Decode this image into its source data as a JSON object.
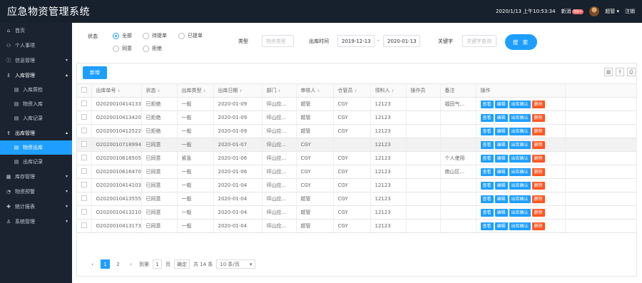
{
  "app": {
    "title": "应急物资管理系统"
  },
  "topbar": {
    "datetime": "2020/1/13 上午10:53:34",
    "news_label": "新消",
    "news_count": "99+",
    "user": "超管",
    "user_arrow": "▾",
    "logout": "注销"
  },
  "sidebar": {
    "items": [
      {
        "label": "首页",
        "icon": "home-icon",
        "glyph": "⌂",
        "arrow": ""
      },
      {
        "label": "个人事项",
        "icon": "user-icon",
        "glyph": "⚇",
        "arrow": ""
      },
      {
        "label": "信息管理",
        "icon": "info-icon",
        "glyph": "ⓘ",
        "arrow": "▾"
      },
      {
        "label": "入库管理",
        "icon": "inbound-icon",
        "glyph": "⇩",
        "arrow": "▴"
      },
      {
        "label": "入库质检",
        "icon": "doc-icon",
        "glyph": "▤",
        "arrow": ""
      },
      {
        "label": "物资入库",
        "icon": "doc-icon",
        "glyph": "▤",
        "arrow": ""
      },
      {
        "label": "入库记录",
        "icon": "doc-icon",
        "glyph": "▤",
        "arrow": ""
      },
      {
        "label": "出库管理",
        "icon": "outbound-icon",
        "glyph": "⇪",
        "arrow": "▴"
      },
      {
        "label": "物资出库",
        "icon": "doc-icon",
        "glyph": "▤",
        "arrow": ""
      },
      {
        "label": "出库记录",
        "icon": "doc-icon",
        "glyph": "▤",
        "arrow": ""
      },
      {
        "label": "库存管理",
        "icon": "stock-icon",
        "glyph": "▦",
        "arrow": "▾"
      },
      {
        "label": "物资预警",
        "icon": "warning-icon",
        "glyph": "◔",
        "arrow": "▾"
      },
      {
        "label": "统计报表",
        "icon": "chart-icon",
        "glyph": "✚",
        "arrow": "▾"
      },
      {
        "label": "系统管理",
        "icon": "settings-icon",
        "glyph": "♙",
        "arrow": "▾"
      }
    ]
  },
  "filters": {
    "status_label": "状态",
    "status_options": [
      "全部",
      "待提单",
      "已提单",
      "同意",
      "拒绝"
    ],
    "status_selected": "全部",
    "type_label": "类型",
    "type_placeholder": "物资类型",
    "date_label": "出库时间",
    "date_from": "2019-12-13",
    "date_sep": "-",
    "date_to": "2020-01-13",
    "keyword_label": "关键字",
    "keyword_placeholder": "关键字查询",
    "search_button": "搜 索"
  },
  "toolbar": {
    "new_button": "新增",
    "icons": [
      "columns-icon",
      "export-icon",
      "print-icon"
    ],
    "icon_glyphs": [
      "▥",
      "⇪",
      "⎙"
    ]
  },
  "table": {
    "headers": [
      "出库单号",
      "状态",
      "出库类型",
      "出库日期",
      "部门",
      "审核人",
      "仓管员",
      "领料人",
      "操作员",
      "备注",
      "操作"
    ],
    "sort_glyph": "⇕",
    "actions": [
      "查看",
      "编辑",
      "出库确认",
      "删除"
    ],
    "rows": [
      [
        "O20200104141337",
        "已拒绝",
        "一般",
        "2020-01-09",
        "坪山应...",
        "超管",
        "CGY",
        "12123",
        "",
        "福田气..."
      ],
      [
        "O20200104134201",
        "已拒绝",
        "一般",
        "2020-01-09",
        "坪山应...",
        "超管",
        "CGY",
        "12123",
        "",
        ""
      ],
      [
        "O20200104125229",
        "已拒绝",
        "一般",
        "2020-01-09",
        "坪山应...",
        "超管",
        "CGY",
        "12123",
        "",
        ""
      ],
      [
        "O20200107189946",
        "已同意",
        "一般",
        "2020-01-07",
        "坪山应...",
        "CGY",
        "",
        "12123",
        "",
        ""
      ],
      [
        "O20200106165051",
        "已同意",
        "紧急",
        "2020-01-06",
        "坪山应...",
        "CGY",
        "CGY",
        "12123",
        "",
        "个人使用"
      ],
      [
        "O20200106164703",
        "已同意",
        "一般",
        "2020-01-06",
        "坪山应...",
        "CGY",
        "CGY",
        "12123",
        "",
        "南山区..."
      ],
      [
        "O20200104141032",
        "已同意",
        "一般",
        "2020-01-04",
        "坪山应...",
        "CGY",
        "CGY",
        "12123",
        "",
        ""
      ],
      [
        "O20200104135553",
        "已同意",
        "一般",
        "2020-01-04",
        "坪山应...",
        "超管",
        "CGY",
        "12123",
        "",
        ""
      ],
      [
        "O20200104132107",
        "已同意",
        "一般",
        "2020-01-04",
        "坪山应...",
        "超管",
        "CGY",
        "12123",
        "",
        ""
      ],
      [
        "O20200104131733",
        "已同意",
        "一般",
        "2020-01-04",
        "坪山应...",
        "超管",
        "CGY",
        "12123",
        "",
        ""
      ]
    ]
  },
  "pager": {
    "prev": "‹",
    "pages": [
      "1",
      "2"
    ],
    "current": "1",
    "next": "›",
    "goto_label": "到第",
    "goto_value": "1",
    "page_unit": "页",
    "confirm": "确定",
    "total": "共 14 条",
    "size_option": "10 条/页",
    "size_arrow": "▾"
  }
}
